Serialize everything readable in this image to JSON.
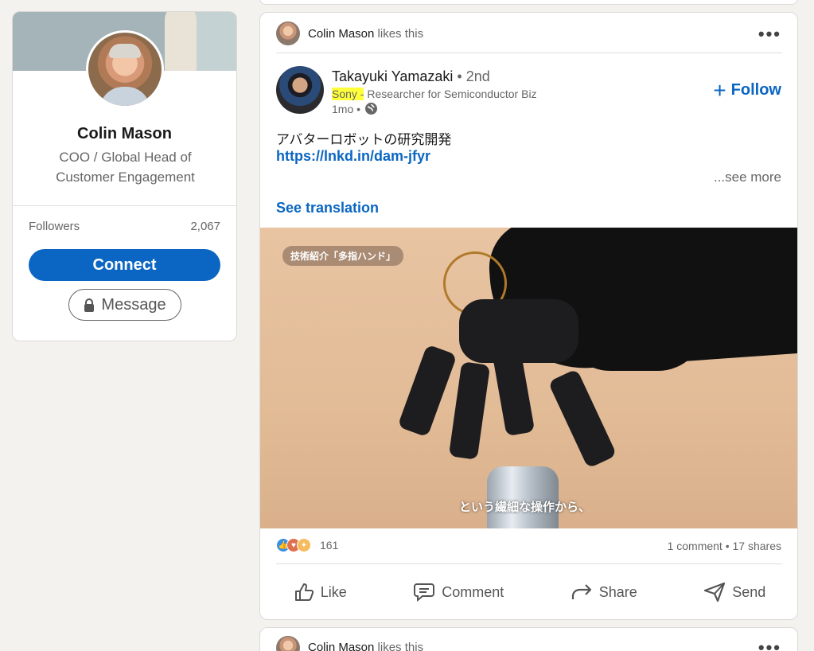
{
  "profile": {
    "name": "Colin Mason",
    "headline": "COO / Global Head of Customer Engagement",
    "followers_label": "Followers",
    "followers_count": "2,067",
    "connect_label": "Connect",
    "message_label": "Message"
  },
  "post": {
    "social_actor": "Colin Mason",
    "social_action": "likes this",
    "author": {
      "name": "Takayuki Yamazaki",
      "degree": "• 2nd",
      "headline_highlight": "Sony -",
      "headline_rest": "Researcher for Semiconductor Biz",
      "time": "1mo •"
    },
    "follow_label": "Follow",
    "text": "アバターロボットの研究開発",
    "link": "https://lnkd.in/dam-jfyr",
    "see_more": "...see more",
    "see_translation": "See translation",
    "media": {
      "badge": "技術紹介「多指ハンド」",
      "caption": "という繊細な操作から、"
    },
    "reaction_count": "161",
    "stats": "1 comment • 17 shares",
    "actions": {
      "like": "Like",
      "comment": "Comment",
      "share": "Share",
      "send": "Send"
    }
  },
  "next_post": {
    "social_actor": "Colin Mason",
    "social_action": "likes this"
  },
  "colors": {
    "brand_blue": "#0a66c2",
    "background": "#f3f2ef",
    "highlight": "#ffff3a"
  }
}
